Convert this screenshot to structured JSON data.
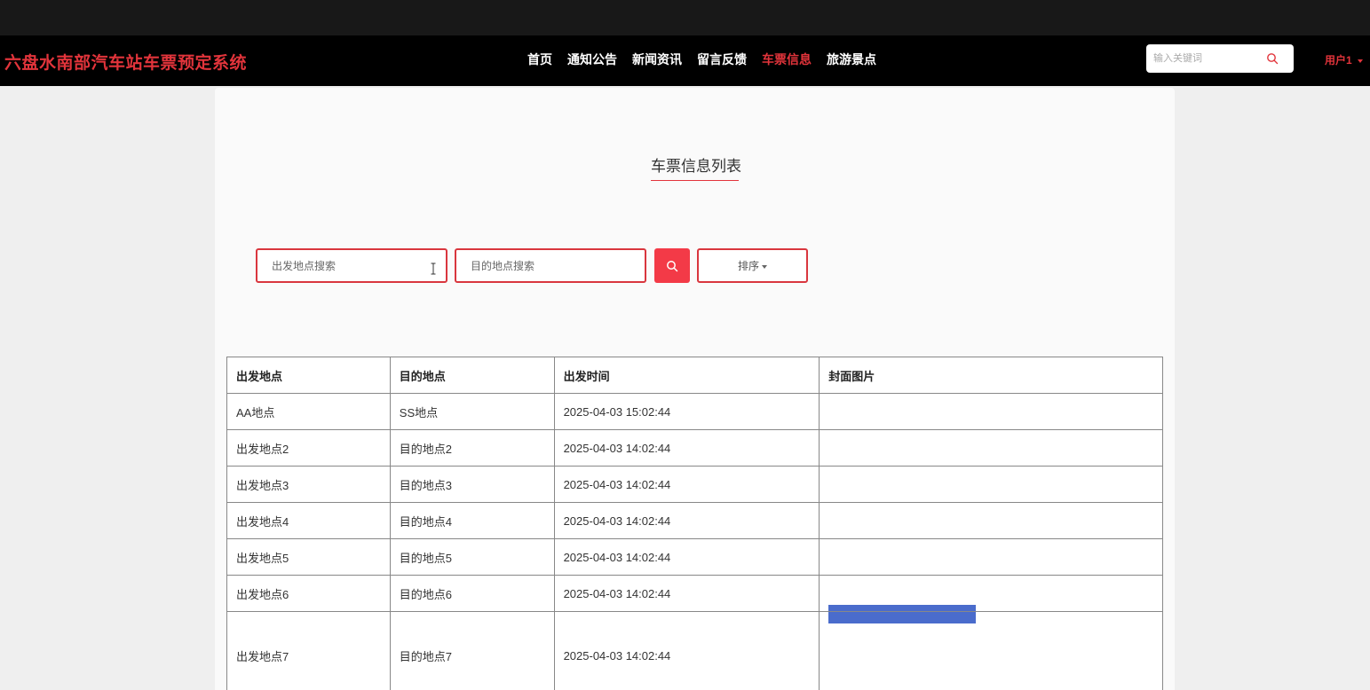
{
  "app": {
    "brand": "六盘水南部汽车站车票预定系统"
  },
  "nav": {
    "items": [
      {
        "label": "首页",
        "active": false
      },
      {
        "label": "通知公告",
        "active": false
      },
      {
        "label": "新闻资讯",
        "active": false
      },
      {
        "label": "留言反馈",
        "active": false
      },
      {
        "label": "车票信息",
        "active": true
      },
      {
        "label": "旅游景点",
        "active": false
      }
    ],
    "search_placeholder": "输入关键词",
    "user_label": "用户1"
  },
  "page": {
    "title": "车票信息列表"
  },
  "filters": {
    "origin_placeholder": "出发地点搜索",
    "destination_placeholder": "目的地点搜索",
    "sort_label": "排序"
  },
  "table": {
    "headers": [
      "出发地点",
      "目的地点",
      "出发时间",
      "封面图片"
    ],
    "rows": [
      [
        "AA地点",
        "SS地点",
        "2025-04-03 15:02:44"
      ],
      [
        "出发地点2",
        "目的地点2",
        "2025-04-03 14:02:44"
      ],
      [
        "出发地点3",
        "目的地点3",
        "2025-04-03 14:02:44"
      ],
      [
        "出发地点4",
        "目的地点4",
        "2025-04-03 14:02:44"
      ],
      [
        "出发地点5",
        "目的地点5",
        "2025-04-03 14:02:44"
      ],
      [
        "出发地点6",
        "目的地点6",
        "2025-04-03 14:02:44"
      ],
      [
        "出发地点7",
        "目的地点7",
        "2025-04-03 14:02:44"
      ]
    ]
  },
  "colors": {
    "accent": "#e2343b",
    "nav_bg": "#000000",
    "button_red": "#f33a47"
  }
}
